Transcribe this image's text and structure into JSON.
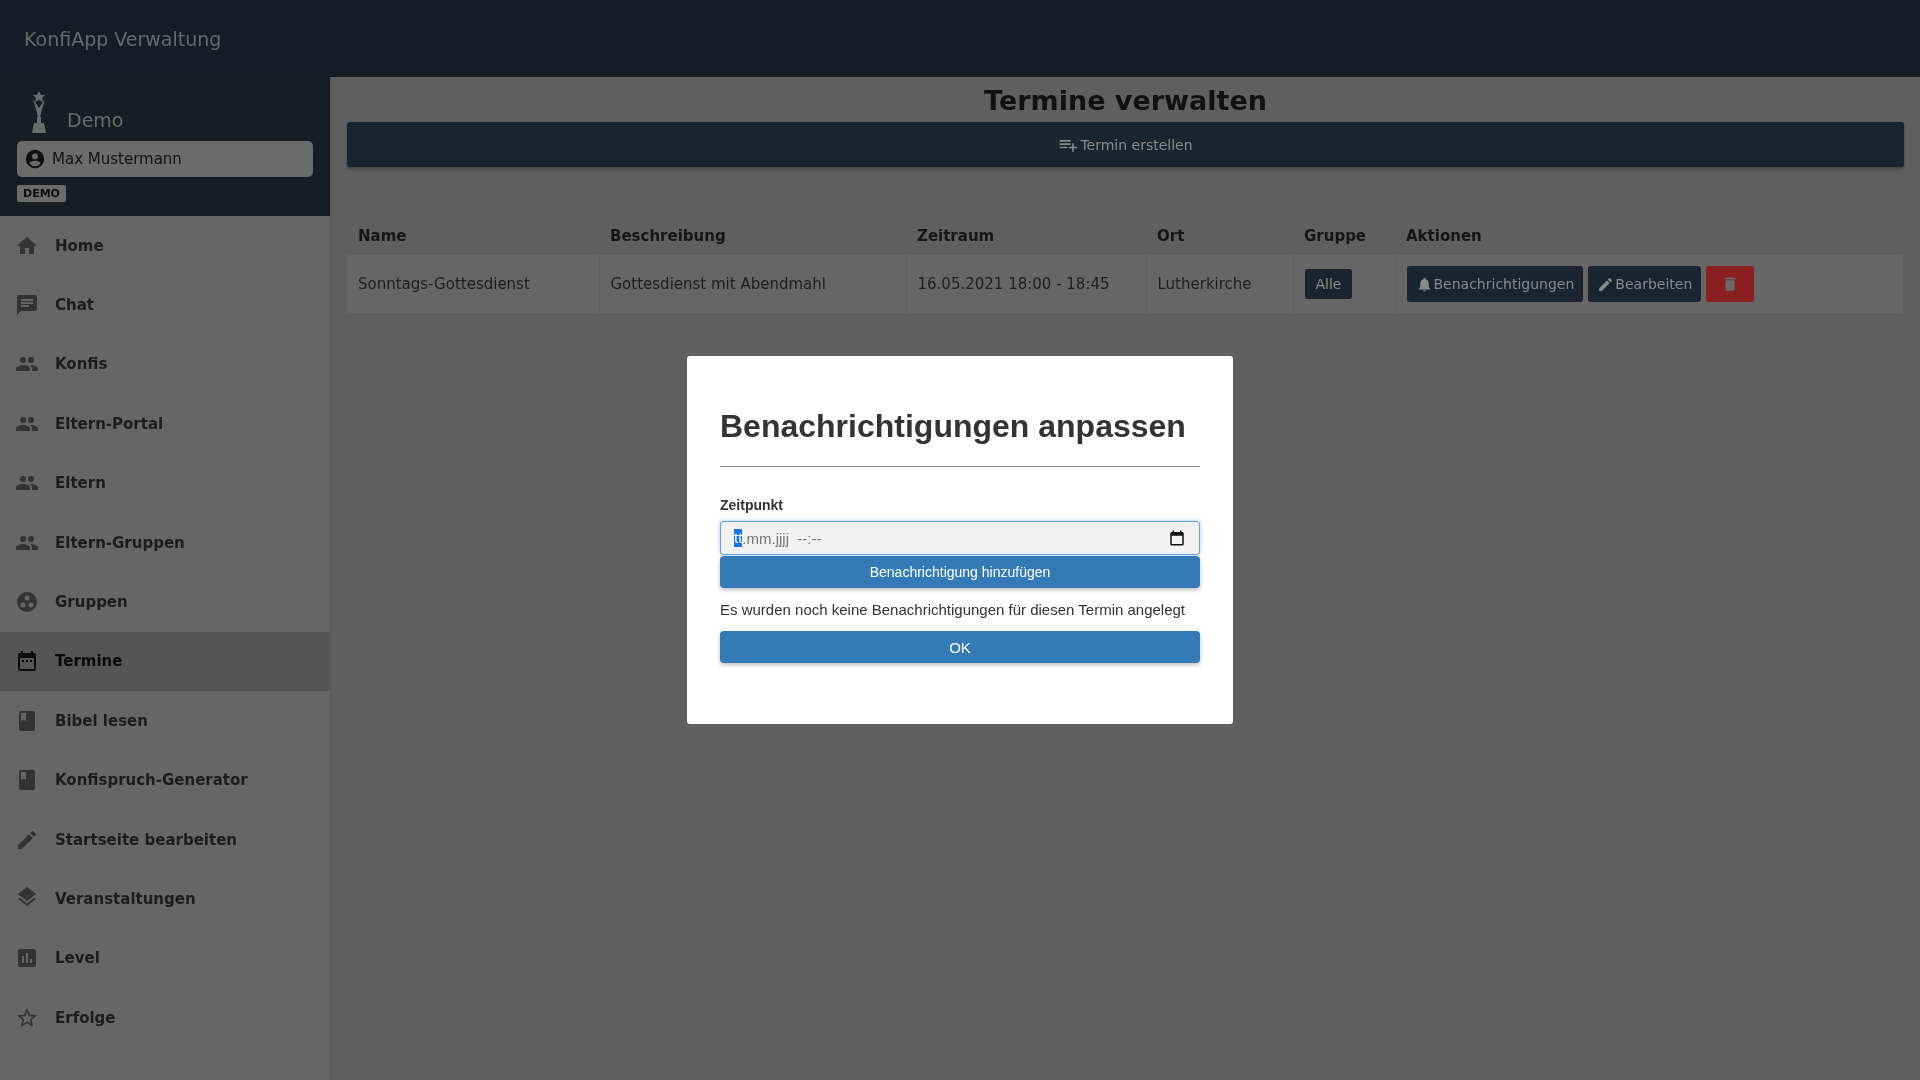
{
  "app_bar": {
    "title": "KonfiApp Verwaltung"
  },
  "sidebar": {
    "org": "Demo",
    "user": "Max Mustermann",
    "badge": "DEMO",
    "items": [
      {
        "label": "Home",
        "selected": false
      },
      {
        "label": "Chat",
        "selected": false
      },
      {
        "label": "Konfis",
        "selected": false
      },
      {
        "label": "Eltern-Portal",
        "selected": false
      },
      {
        "label": "Eltern",
        "selected": false
      },
      {
        "label": "Eltern-Gruppen",
        "selected": false
      },
      {
        "label": "Gruppen",
        "selected": false
      },
      {
        "label": "Termine",
        "selected": true
      },
      {
        "label": "Bibel lesen",
        "selected": false
      },
      {
        "label": "Konfispruch-Generator",
        "selected": false
      },
      {
        "label": "Startseite bearbeiten",
        "selected": false
      },
      {
        "label": "Veranstaltungen",
        "selected": false
      },
      {
        "label": "Level",
        "selected": false
      },
      {
        "label": "Erfolge",
        "selected": false
      }
    ]
  },
  "page": {
    "title": "Termine verwalten",
    "create_button": "Termin erstellen"
  },
  "table": {
    "columns": [
      "Name",
      "Beschreibung",
      "Zeitraum",
      "Ort",
      "Gruppe",
      "Aktionen"
    ],
    "rows": [
      {
        "name": "Sonntags-Gottesdienst",
        "description": "Gottesdienst mit Abendmahl",
        "period": "16.05.2021 18:00 - 18:45",
        "place": "Lutherkirche",
        "group": "Alle",
        "actions": [
          "Benachrichtigungen",
          "Bearbeiten"
        ]
      }
    ]
  },
  "dialog": {
    "title": "Benachrichtigungen anpassen",
    "field_label": "Zeitpunkt",
    "field_parts": [
      {
        "text": "tt",
        "selected": true
      },
      {
        "text": ".mm.jjjj  --:--",
        "selected": false
      }
    ],
    "add_button": "Benachrichtigung hinzufügen",
    "message": "Es wurden noch keine Benachrichtigungen für diesen Termin angelegt",
    "ok_button": "OK"
  }
}
